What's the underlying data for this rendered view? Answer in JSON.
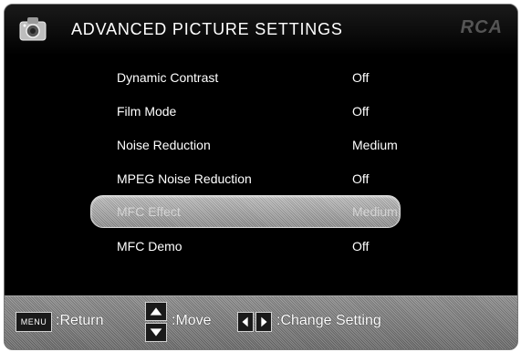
{
  "header": {
    "title": "ADVANCED PICTURE SETTINGS",
    "logo": "RCA",
    "icon": "settings-camera-icon"
  },
  "settings": [
    {
      "label": "Dynamic Contrast",
      "value": "Off"
    },
    {
      "label": "Film Mode",
      "value": "Off"
    },
    {
      "label": "Noise Reduction",
      "value": "Medium"
    },
    {
      "label": "MPEG Noise Reduction",
      "value": "Off"
    },
    {
      "label": "MFC Effect",
      "value": "Medium",
      "selected": true
    },
    {
      "label": "MFC Demo",
      "value": "Off"
    }
  ],
  "footer": {
    "menu_key": "MENU",
    "return_label": ":Return",
    "move_label": ":Move",
    "change_label": ":Change Setting"
  }
}
